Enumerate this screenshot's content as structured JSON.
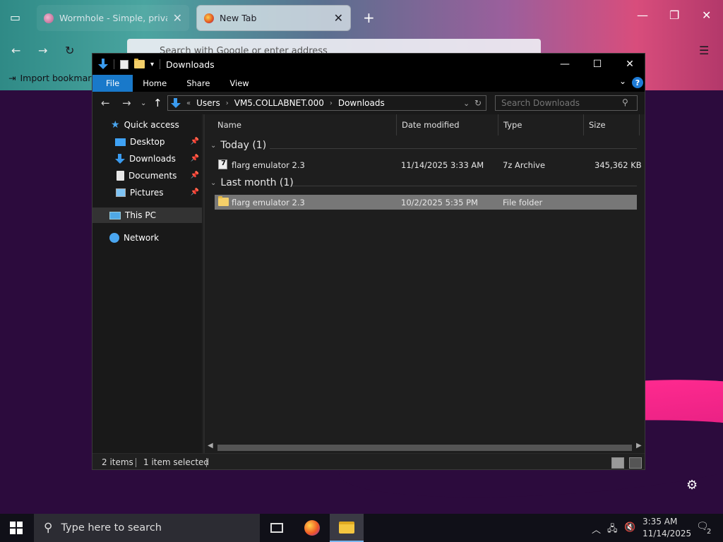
{
  "browser": {
    "tabs": [
      {
        "title": "Wormhole - Simple, private file",
        "active": false
      },
      {
        "title": "New Tab",
        "active": true
      }
    ],
    "address_placeholder": "Search with Google or enter address",
    "bookmarks_label": "Import bookmarks..."
  },
  "explorer": {
    "title": "Downloads",
    "ribbon_tabs": [
      "File",
      "Home",
      "Share",
      "View"
    ],
    "breadcrumb": [
      "Users",
      "VM5.COLLABNET.000",
      "Downloads"
    ],
    "breadcrumb_prefix": "«",
    "search_placeholder": "Search Downloads",
    "nav": {
      "quick_access": "Quick access",
      "items": [
        {
          "label": "Desktop",
          "icon": "desktop-icon",
          "pinned": true
        },
        {
          "label": "Downloads",
          "icon": "downloads-icon",
          "pinned": true
        },
        {
          "label": "Documents",
          "icon": "documents-icon",
          "pinned": true
        },
        {
          "label": "Pictures",
          "icon": "pictures-icon",
          "pinned": true
        }
      ],
      "this_pc": "This PC",
      "network": "Network"
    },
    "columns": [
      "Name",
      "Date modified",
      "Type",
      "Size"
    ],
    "groups": [
      {
        "label": "Today (1)",
        "files": [
          {
            "name": "flarg emulator 2.3",
            "date": "11/14/2025 3:33 AM",
            "type": "7z Archive",
            "size": "345,362 KB",
            "icon": "7z-archive-icon",
            "selected": false
          }
        ]
      },
      {
        "label": "Last month (1)",
        "files": [
          {
            "name": "flarg emulator 2.3",
            "date": "10/2/2025 5:35 PM",
            "type": "File folder",
            "size": "",
            "icon": "folder-icon",
            "selected": true
          }
        ]
      }
    ],
    "status": {
      "items": "2 items",
      "selected": "1 item selected"
    }
  },
  "taskbar": {
    "search_placeholder": "Type here to search",
    "time": "3:35 AM",
    "date": "11/14/2025",
    "notifications": "2"
  }
}
